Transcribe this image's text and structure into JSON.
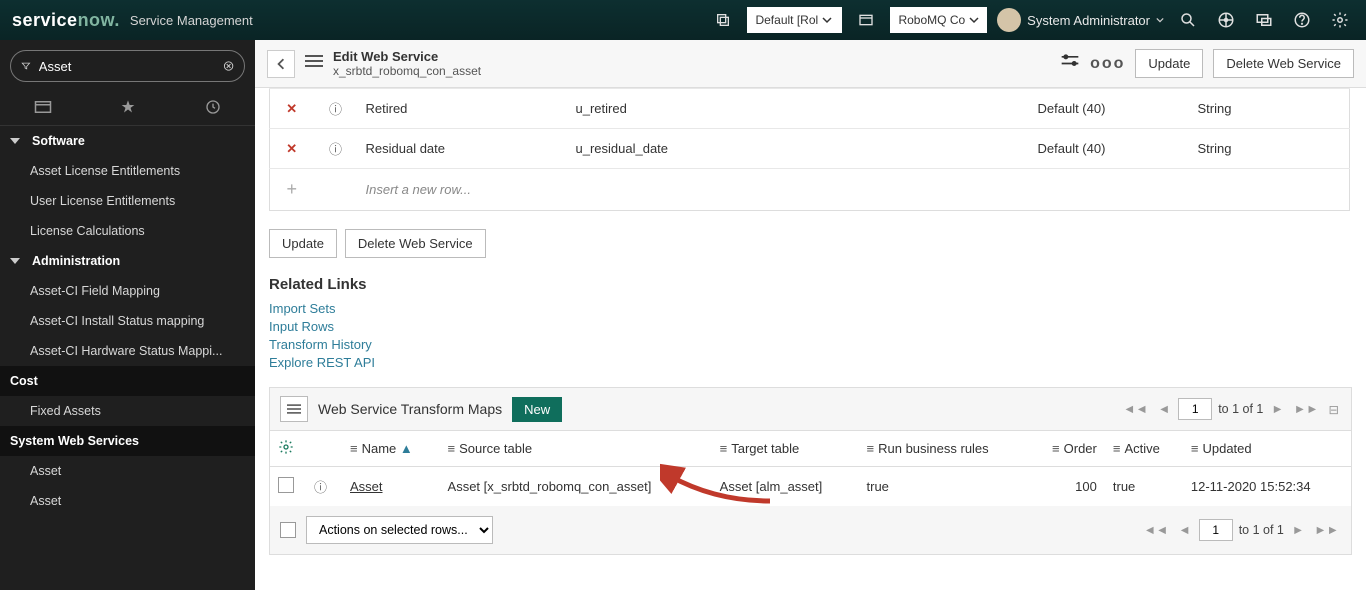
{
  "top": {
    "logo_a": "service",
    "logo_b": "now",
    "banner": "Service Management",
    "picker1": "Default [Rol",
    "picker2": "RoboMQ Co",
    "user": "System Administrator"
  },
  "sidebar": {
    "filter_value": "Asset",
    "items": [
      {
        "kind": "header",
        "label": "Software",
        "arrow": true
      },
      {
        "kind": "leaf",
        "label": "Asset License Entitlements"
      },
      {
        "kind": "leaf",
        "label": "User License Entitlements"
      },
      {
        "kind": "leaf",
        "label": "License Calculations"
      },
      {
        "kind": "header",
        "label": "Administration",
        "arrow": true
      },
      {
        "kind": "leaf",
        "label": "Asset-CI Field Mapping"
      },
      {
        "kind": "leaf",
        "label": "Asset-CI Install Status mapping"
      },
      {
        "kind": "leaf",
        "label": "Asset-CI Hardware Status Mappi..."
      },
      {
        "kind": "top",
        "label": "Cost"
      },
      {
        "kind": "leaf",
        "label": "Fixed Assets"
      },
      {
        "kind": "top",
        "label": "System Web Services"
      },
      {
        "kind": "leaf",
        "label": "Asset"
      },
      {
        "kind": "leaf",
        "label": "Asset"
      }
    ]
  },
  "form": {
    "title": "Edit Web Service",
    "subtitle": "x_srbtd_robomq_con_asset",
    "update": "Update",
    "delete": "Delete Web Service",
    "rows": [
      {
        "label": "Retired",
        "field": "u_retired",
        "len": "Default (40)",
        "type": "String"
      },
      {
        "label": "Residual date",
        "field": "u_residual_date",
        "len": "Default (40)",
        "type": "String"
      }
    ],
    "insert": "Insert a new row..."
  },
  "related": {
    "heading": "Related Links",
    "links": [
      "Import Sets",
      "Input Rows",
      "Transform History",
      "Explore REST API"
    ]
  },
  "list": {
    "title": "Web Service Transform Maps",
    "new": "New",
    "page": "1",
    "page_range": "to 1 of 1",
    "cols": [
      "Name",
      "Source table",
      "Target table",
      "Run business rules",
      "Order",
      "Active",
      "Updated"
    ],
    "row": {
      "name": "Asset",
      "source": "Asset [x_srbtd_robomq_con_asset]",
      "target": "Asset [alm_asset]",
      "rules": "true",
      "order": "100",
      "active": "true",
      "updated": "12-11-2020 15:52:34"
    },
    "actions": "Actions on selected rows...",
    "page2": "1",
    "page_range2": "to 1 of 1"
  }
}
